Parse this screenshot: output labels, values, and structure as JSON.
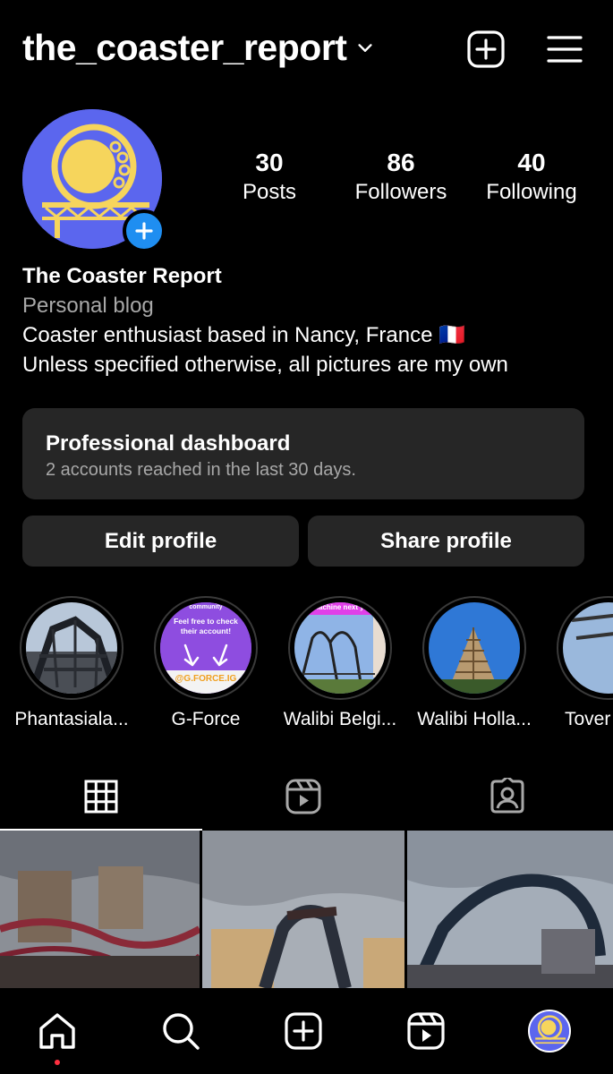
{
  "header": {
    "username": "the_coaster_report"
  },
  "profile": {
    "stats": [
      {
        "value": "30",
        "label": "Posts"
      },
      {
        "value": "86",
        "label": "Followers"
      },
      {
        "value": "40",
        "label": "Following"
      }
    ],
    "name": "The Coaster Report",
    "category": "Personal blog",
    "bio_lines": [
      "Coaster enthusiast based in Nancy, France 🇫🇷",
      "Unless specified otherwise, all pictures are my own"
    ]
  },
  "dashboard": {
    "title": "Professional dashboard",
    "subtitle": "2 accounts reached in the last 30 days."
  },
  "buttons": {
    "edit": "Edit profile",
    "share": "Share profile"
  },
  "highlights": [
    {
      "label": "Phantasiala..."
    },
    {
      "label": "G-Force",
      "overlay_top": "community",
      "overlay_mid": "Feel free to check their account!",
      "overlay_bottom": "@G.FORCE.IG"
    },
    {
      "label": "Walibi Belgi...",
      "overlay_top": "machine next ye"
    },
    {
      "label": "Walibi Holla..."
    },
    {
      "label": "Tover"
    }
  ],
  "icons": {
    "header": [
      "chevron-down-icon",
      "add-post-icon",
      "menu-icon"
    ],
    "tabs": [
      "grid-icon",
      "reels-icon",
      "tagged-icon"
    ],
    "nav": [
      "home-icon",
      "search-icon",
      "create-icon",
      "reels-icon",
      "profile-avatar"
    ]
  },
  "colors": {
    "background": "#000000",
    "card": "#262626",
    "secondary_text": "#a8a8a8",
    "accent_blue": "#1f8ef1",
    "avatar_bg": "#5b66ee",
    "logo_yellow": "#f6d55c",
    "notification_dot": "#ff3040"
  }
}
